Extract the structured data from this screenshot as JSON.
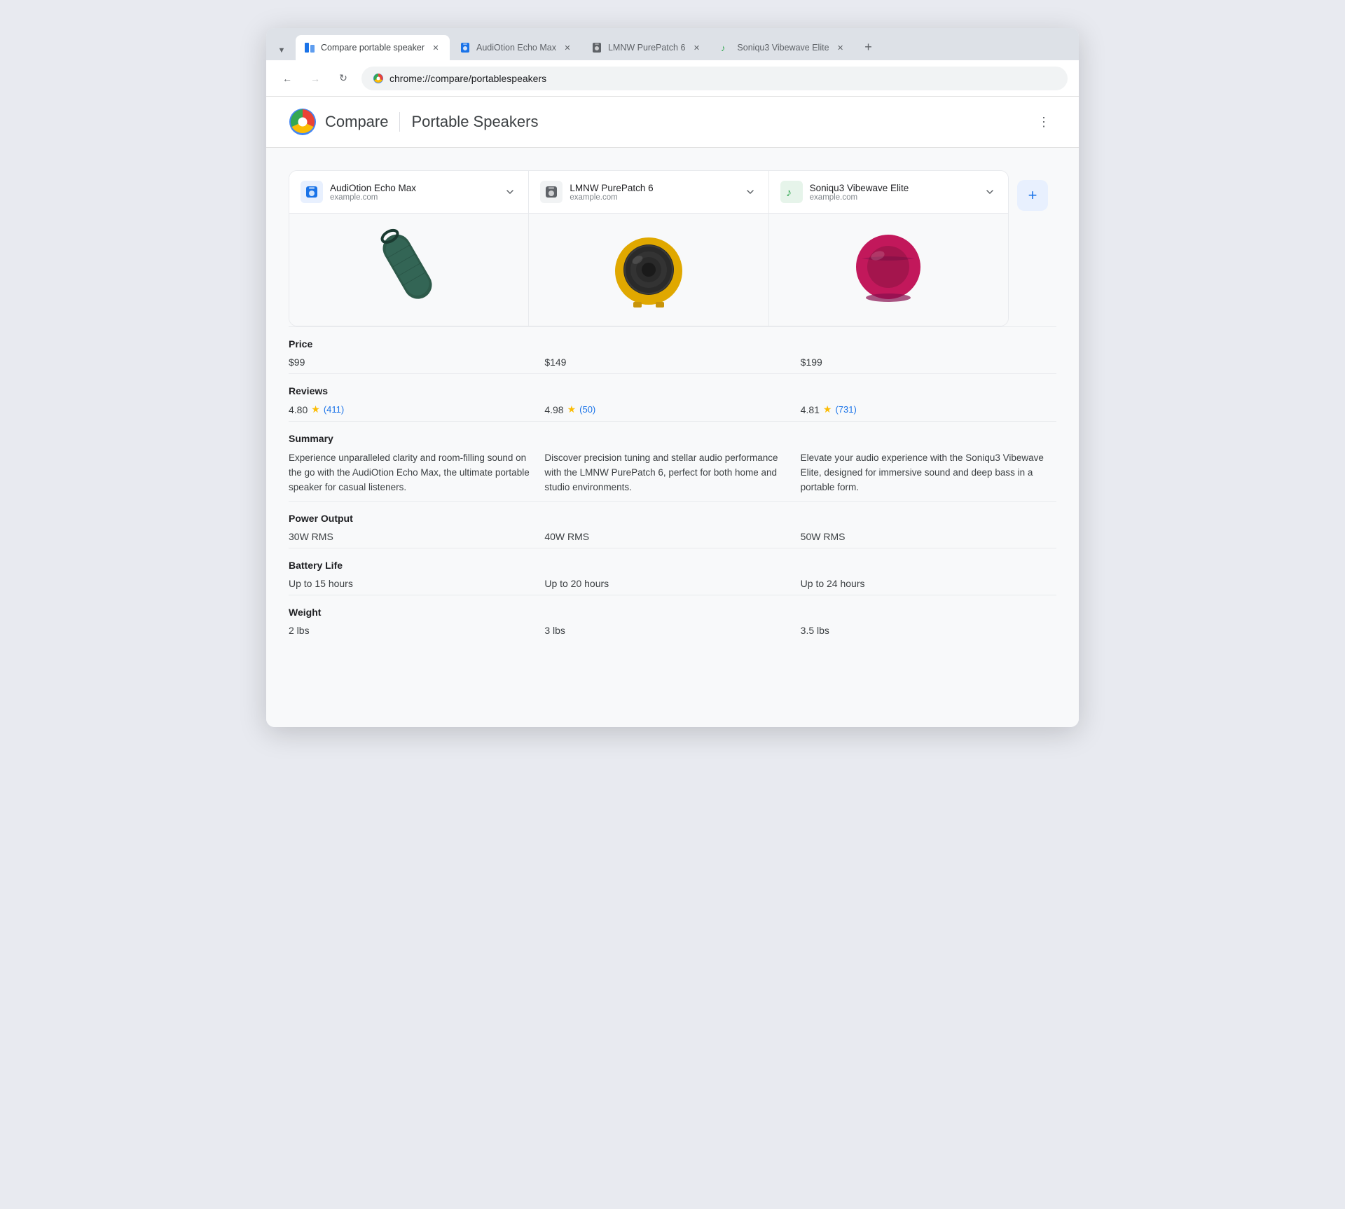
{
  "browser": {
    "tabs": [
      {
        "id": "tab-compare",
        "label": "Compare portable speaker",
        "active": true,
        "icon_type": "compare",
        "icon_color": "#1a73e8"
      },
      {
        "id": "tab-audio",
        "label": "AudiOtion Echo Max",
        "active": false,
        "icon_type": "speaker",
        "icon_color": "#1a73e8"
      },
      {
        "id": "tab-lmnw",
        "label": "LMNW PurePatch 6",
        "active": false,
        "icon_type": "speaker",
        "icon_color": "#1a73e8"
      },
      {
        "id": "tab-soniqu",
        "label": "Soniqu3 Vibewave Elite",
        "active": false,
        "icon_type": "music",
        "icon_color": "#34a853"
      }
    ],
    "url": "chrome://compare/portablespeakers",
    "url_icon": "🔒"
  },
  "page": {
    "header": {
      "brand": "Compare",
      "title": "Portable Speakers",
      "menu_label": "⋮"
    },
    "products": [
      {
        "name": "AudiOtion Echo Max",
        "domain": "example.com",
        "icon_color": "#1a73e8",
        "icon_type": "speaker_box",
        "image_color": "#2d6a4f",
        "price": "$99",
        "review_score": "4.80",
        "review_count": "411",
        "summary": "Experience unparalleled clarity and room-filling sound on the go with the AudiOtion Echo Max, the ultimate portable speaker for casual listeners.",
        "power_output": "30W RMS",
        "battery_life": "Up to 15 hours",
        "weight": "2 lbs"
      },
      {
        "name": "LMNW PurePatch 6",
        "domain": "example.com",
        "icon_color": "#5f6368",
        "icon_type": "speaker_round",
        "image_color": "#e0a800",
        "price": "$149",
        "review_score": "4.98",
        "review_count": "50",
        "summary": "Discover precision tuning and stellar audio performance with the LMNW PurePatch 6, perfect for both home and studio environments.",
        "power_output": "40W RMS",
        "battery_life": "Up to 20 hours",
        "weight": "3 lbs"
      },
      {
        "name": "Soniqu3 Vibewave Elite",
        "domain": "example.com",
        "icon_color": "#34a853",
        "icon_type": "music_note",
        "image_color": "#c2185b",
        "price": "$199",
        "review_score": "4.81",
        "review_count": "731",
        "summary": "Elevate your audio experience with the Soniqu3 Vibewave Elite, designed for immersive sound and deep bass in a portable form.",
        "power_output": "50W RMS",
        "battery_life": "Up to 24 hours",
        "weight": "3.5 lbs"
      }
    ],
    "sections": [
      {
        "id": "price",
        "label": "Price"
      },
      {
        "id": "reviews",
        "label": "Reviews"
      },
      {
        "id": "summary",
        "label": "Summary"
      },
      {
        "id": "power_output",
        "label": "Power Output"
      },
      {
        "id": "battery_life",
        "label": "Battery Life"
      },
      {
        "id": "weight",
        "label": "Weight"
      }
    ],
    "add_button_label": "+"
  }
}
